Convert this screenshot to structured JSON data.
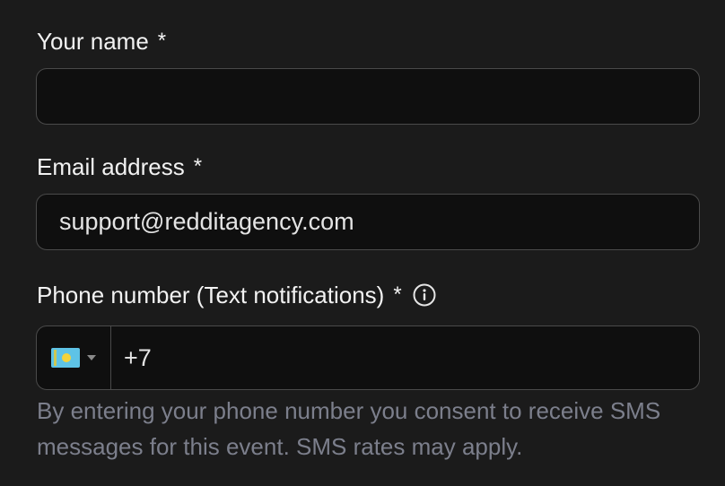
{
  "form": {
    "name": {
      "label": "Your name",
      "required_mark": "*",
      "value": "",
      "placeholder": ""
    },
    "email": {
      "label": "Email address",
      "required_mark": "*",
      "value": "support@redditagency.com",
      "placeholder": ""
    },
    "phone": {
      "label": "Phone number (Text notifications)",
      "required_mark": "*",
      "info_icon": "info-circle-icon",
      "country_flag": "kazakhstan-flag-icon",
      "value": "+7",
      "hint": "By entering your phone number you consent to receive SMS messages for this event. SMS rates may apply."
    }
  },
  "colors": {
    "background": "#1b1b1b",
    "input_background": "#0f0f0f",
    "input_border": "#4a4a4a",
    "label_text": "#f2f2f2",
    "hint_text": "#7c7f8c"
  }
}
